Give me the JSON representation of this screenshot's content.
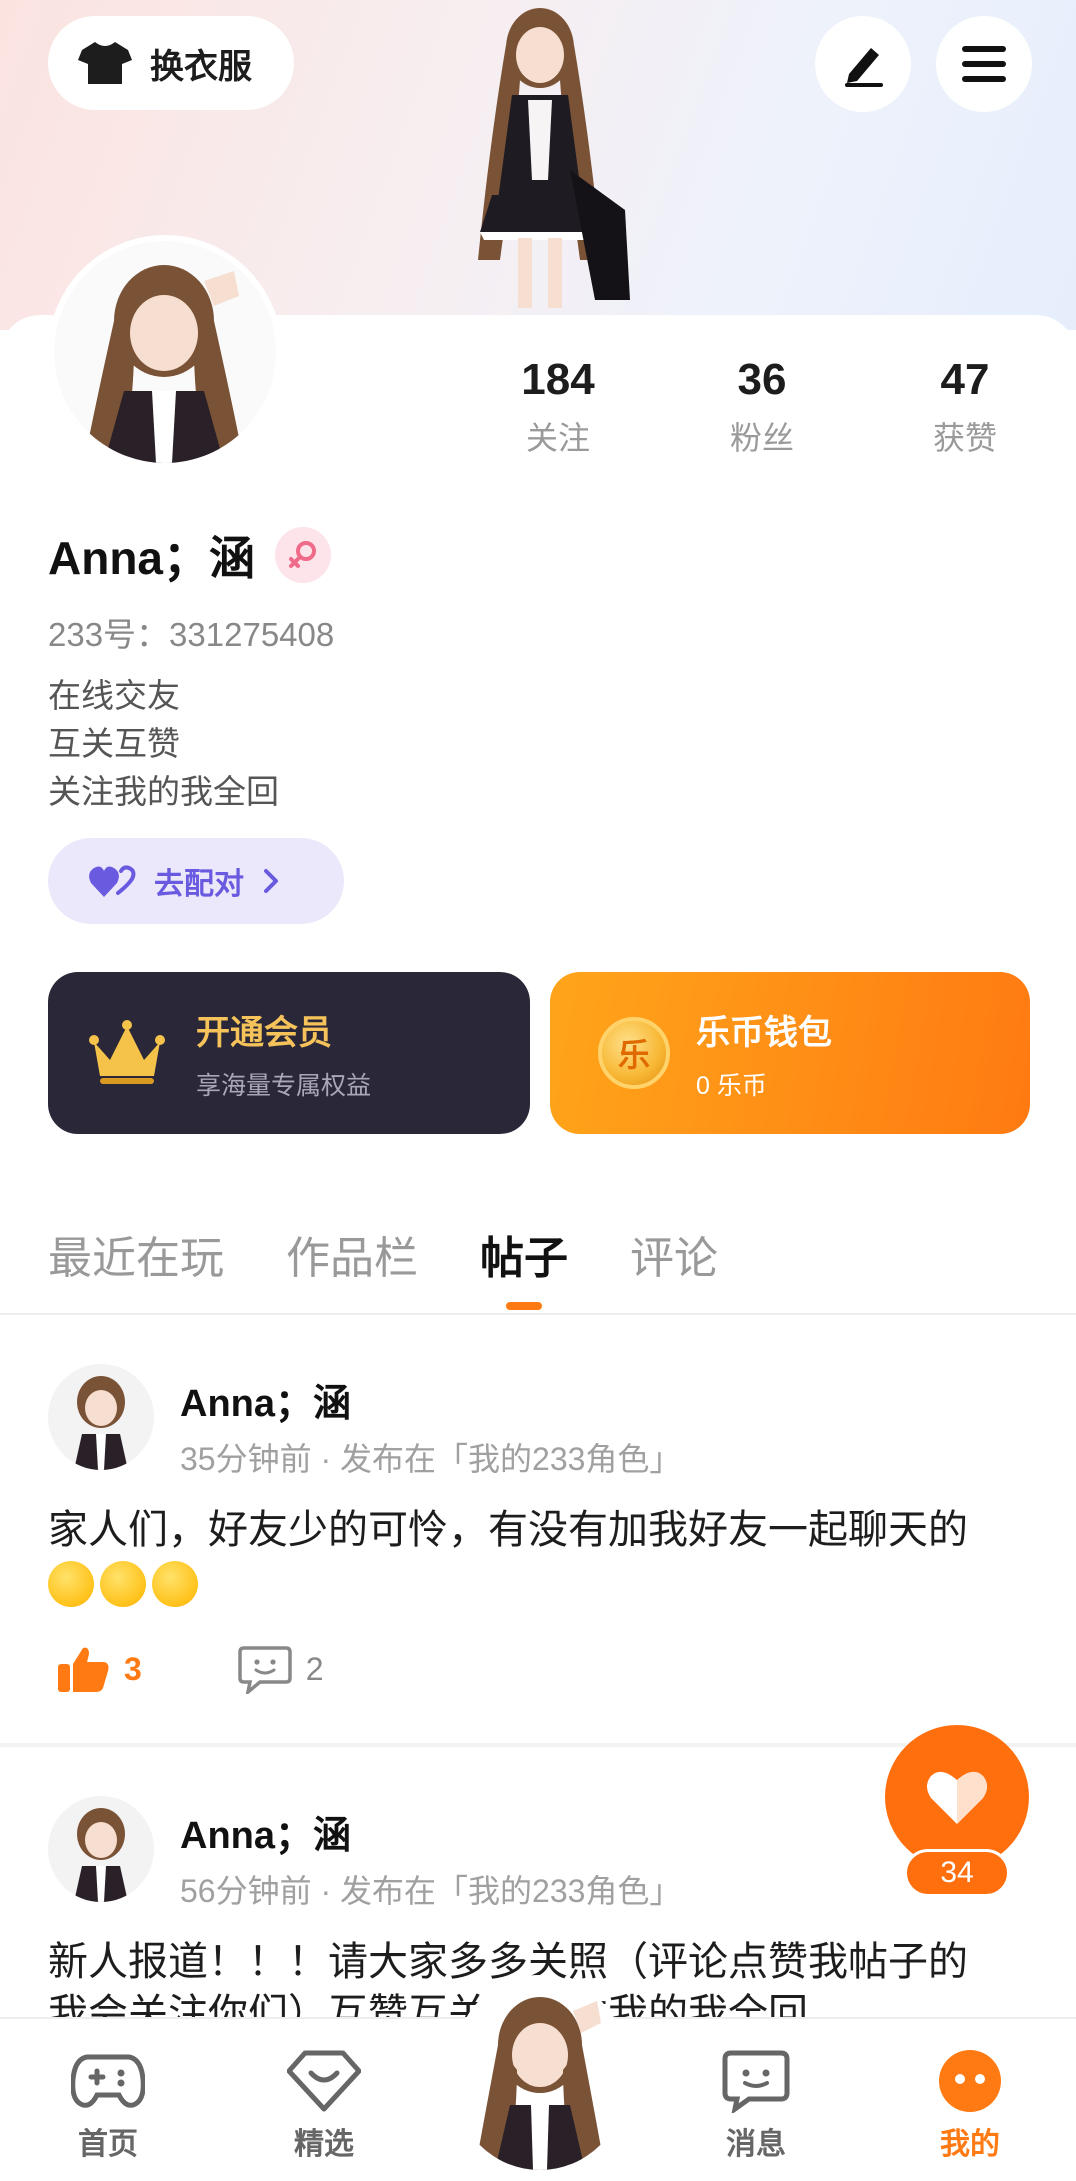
{
  "header": {
    "outfit_label": "换衣服",
    "icons": [
      "tshirt-icon",
      "pencil-icon",
      "menu-icon"
    ]
  },
  "profile": {
    "stats": [
      {
        "value": "184",
        "label": "关注"
      },
      {
        "value": "36",
        "label": "粉丝"
      },
      {
        "value": "47",
        "label": "获赞"
      }
    ],
    "name": "Anna；涵",
    "uid": "233号：331275408",
    "bio": [
      "在线交友",
      "互关互赞",
      "关注我的我全回"
    ],
    "match_label": "去配对"
  },
  "promos": {
    "vip": {
      "title": "开通会员",
      "subtitle": "享海量专属权益"
    },
    "wallet": {
      "title": "乐币钱包",
      "subtitle": "0 乐币",
      "coin_char": "乐"
    }
  },
  "tabs": [
    {
      "label": "最近在玩",
      "active": false
    },
    {
      "label": "作品栏",
      "active": false
    },
    {
      "label": "帖子",
      "active": true
    },
    {
      "label": "评论",
      "active": false
    }
  ],
  "posts": [
    {
      "author": "Anna；涵",
      "meta": "35分钟前 · 发布在「我的233角色」",
      "text": "家人们，好友少的可怜，有没有加我好友一起聊天的",
      "likes": "3",
      "comments": "2"
    },
    {
      "author": "Anna；涵",
      "meta": "56分钟前 · 发布在「我的233角色」",
      "text": "新人报道！！！请大家多多关照（评论点赞我帖子的",
      "text2": "我会关注你们）互赞互关，关注我的我全回"
    }
  ],
  "fab": {
    "count": "34"
  },
  "bottom_nav": [
    {
      "label": "首页",
      "icon": "gamepad-icon"
    },
    {
      "label": "精选",
      "icon": "heart-diamond-icon"
    },
    {
      "label": "消息",
      "icon": "chat-icon"
    },
    {
      "label": "我的",
      "icon": "profile-dots-icon",
      "active": true
    }
  ],
  "colors": {
    "accent": "#ff7a12",
    "vip_bg": "#2a2838",
    "match_bg": "#ebe8fb",
    "match_text": "#6a5ae0"
  }
}
